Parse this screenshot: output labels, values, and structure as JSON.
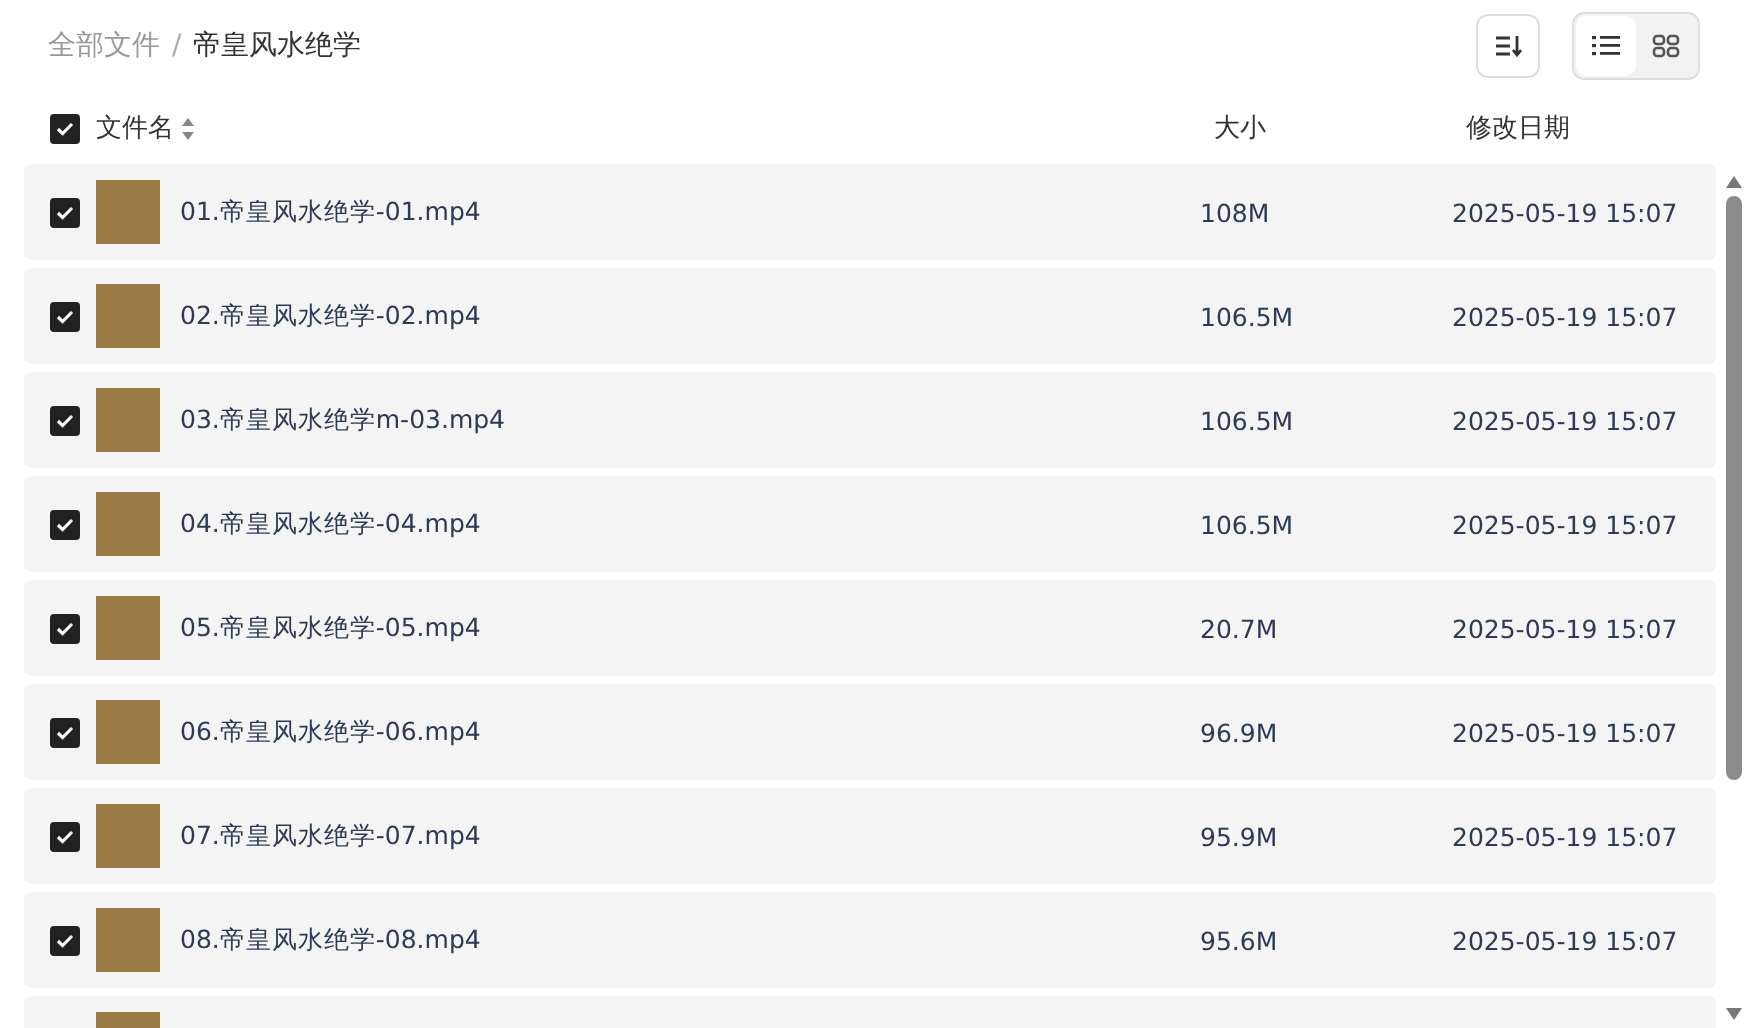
{
  "breadcrumb": [
    {
      "label": "全部文件",
      "current": false
    },
    {
      "label": "帝皇风水绝学",
      "current": true
    }
  ],
  "breadcrumb_separator": "/",
  "view_toggle": [
    {
      "kind": "list",
      "selected": true
    },
    {
      "kind": "grid",
      "selected": false
    }
  ],
  "table": {
    "select_all": {
      "checked": true
    },
    "columns": [
      "文件名",
      "大小",
      "修改日期"
    ],
    "rows": [
      {
        "checked": true,
        "name": "01.帝皇风水绝学-01.mp4",
        "size": "108M",
        "modified": "2025-05-19 15:07"
      },
      {
        "checked": true,
        "name": "02.帝皇风水绝学-02.mp4",
        "size": "106.5M",
        "modified": "2025-05-19 15:07"
      },
      {
        "checked": true,
        "name": "03.帝皇风水绝学m-03.mp4",
        "size": "106.5M",
        "modified": "2025-05-19 15:07"
      },
      {
        "checked": true,
        "name": "04.帝皇风水绝学-04.mp4",
        "size": "106.5M",
        "modified": "2025-05-19 15:07"
      },
      {
        "checked": true,
        "name": "05.帝皇风水绝学-05.mp4",
        "size": "20.7M",
        "modified": "2025-05-19 15:07"
      },
      {
        "checked": true,
        "name": "06.帝皇风水绝学-06.mp4",
        "size": "96.9M",
        "modified": "2025-05-19 15:07"
      },
      {
        "checked": true,
        "name": "07.帝皇风水绝学-07.mp4",
        "size": "95.9M",
        "modified": "2025-05-19 15:07"
      },
      {
        "checked": true,
        "name": "08.帝皇风水绝学-08.mp4",
        "size": "95.6M",
        "modified": "2025-05-19 15:07"
      },
      {}
    ]
  }
}
